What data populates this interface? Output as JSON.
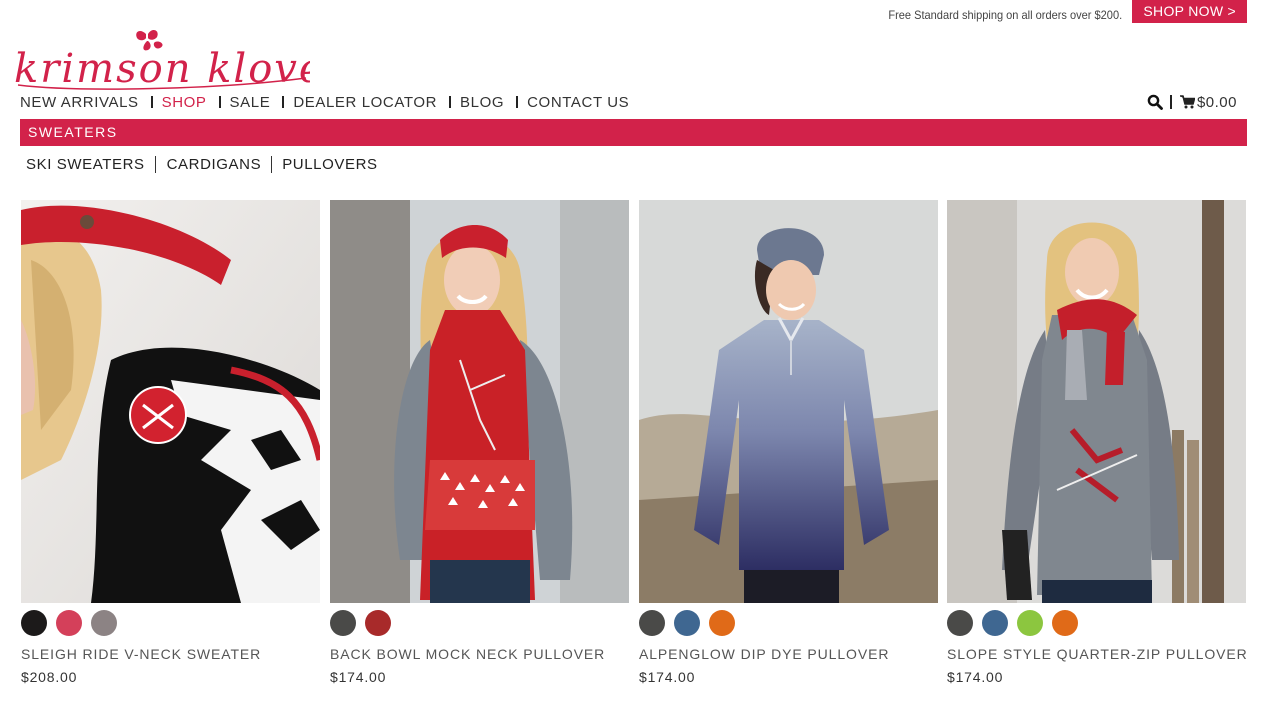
{
  "promo": {
    "text": "Free Standard shipping on all orders over $200.",
    "button": "SHOP NOW >"
  },
  "brand": {
    "name": "Krimson Klover",
    "logo_text": "krimson klover",
    "accent_color": "#d2224a"
  },
  "nav": {
    "items": [
      {
        "label": "NEW ARRIVALS",
        "active": false
      },
      {
        "label": "SHOP",
        "active": true
      },
      {
        "label": "SALE",
        "active": false
      },
      {
        "label": "DEALER LOCATOR",
        "active": false
      },
      {
        "label": "BLOG",
        "active": false
      },
      {
        "label": "CONTACT US",
        "active": false
      }
    ]
  },
  "utility": {
    "search_icon": "search-icon",
    "cart_icon": "cart-icon",
    "cart_total": "$0.00"
  },
  "category": {
    "title": "SWEATERS"
  },
  "subnav": {
    "items": [
      "SKI SWEATERS",
      "CARDIGANS",
      "PULLOVERS"
    ]
  },
  "products": [
    {
      "name": "SLEIGH RIDE V-NECK SWEATER",
      "price": "$208.00",
      "swatches": [
        "#1c1a1a",
        "#d4405a",
        "#8c8384"
      ]
    },
    {
      "name": "BACK BOWL MOCK NECK PULLOVER",
      "price": "$174.00",
      "swatches": [
        "#4a4a48",
        "#a82a2a"
      ]
    },
    {
      "name": "ALPENGLOW DIP DYE PULLOVER",
      "price": "$174.00",
      "swatches": [
        "#4a4a48",
        "#3f6791",
        "#e06a18"
      ]
    },
    {
      "name": "SLOPE STYLE QUARTER-ZIP PULLOVER",
      "price": "$174.00",
      "swatches": [
        "#4a4a48",
        "#3f6791",
        "#8cc63f",
        "#e06a18"
      ]
    }
  ]
}
